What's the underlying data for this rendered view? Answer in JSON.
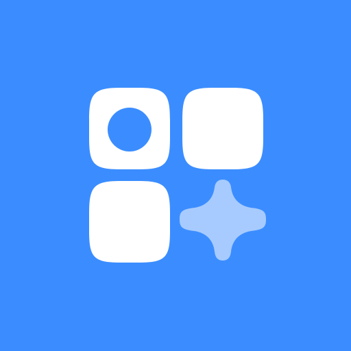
{
  "icon": {
    "name": "widgets-grid-sparkle-icon",
    "colors": {
      "background": "#3B8DFF",
      "tile": "#FFFFFF",
      "sparkle": "#A7CBFF"
    },
    "tiles": [
      {
        "name": "tile-ring",
        "shape": "rounded-square-with-circular-hole"
      },
      {
        "name": "tile-solid-top-right",
        "shape": "rounded-square"
      },
      {
        "name": "tile-solid-bottom-left",
        "shape": "rounded-square"
      }
    ],
    "accent": {
      "name": "sparkle",
      "shape": "four-point-star"
    }
  }
}
